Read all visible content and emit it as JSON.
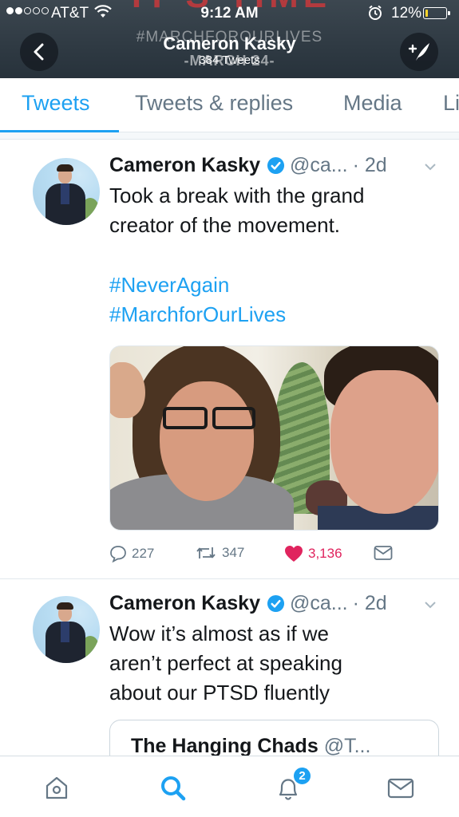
{
  "status_bar": {
    "carrier": "AT&T",
    "time": "9:12 AM",
    "battery": "12%",
    "battery_level": 0.12,
    "signal_bars_filled": 2,
    "signal_bars_total": 5
  },
  "header": {
    "banner_text": "IT'S TIME",
    "banner_hashtag": "#MARCHFOROURLIVES",
    "banner_date": "-MARCH 24-",
    "profile_name": "Cameron Kasky",
    "tweet_count": "384 Tweets",
    "icons": {
      "back": "back-chevron-icon",
      "compose": "compose-tweet-icon"
    }
  },
  "tabs": [
    {
      "label": "Tweets",
      "active": true
    },
    {
      "label": "Tweets & replies",
      "active": false
    },
    {
      "label": "Media",
      "active": false
    },
    {
      "label": "Li",
      "active": false
    }
  ],
  "tweets": [
    {
      "author": "Cameron Kasky",
      "handle": "@ca...",
      "time": "· 2d",
      "text_lines": [
        "Took a break with the grand",
        "creator of the movement."
      ],
      "hashtags": [
        "#NeverAgain",
        "#MarchforOurLives"
      ],
      "actions": {
        "replies": "227",
        "retweets": "347",
        "likes": "3,136"
      }
    },
    {
      "author": "Cameron Kasky",
      "handle": "@ca...",
      "time": "· 2d",
      "text_lines": [
        "Wow it’s almost as if we",
        "aren’t perfect at speaking",
        "about our PTSD fluently"
      ],
      "quote": {
        "name": "The Hanging Chads",
        "handle": "@T..."
      }
    }
  ],
  "bottom_nav": {
    "items": [
      "home-icon",
      "search-icon",
      "notifications-icon",
      "messages-icon"
    ],
    "active": "search-icon",
    "notification_badge": "2"
  },
  "colors": {
    "accent": "#1da1f2",
    "like": "#e0245e",
    "header_bg": "#2f3a43",
    "muted": "#657786"
  }
}
